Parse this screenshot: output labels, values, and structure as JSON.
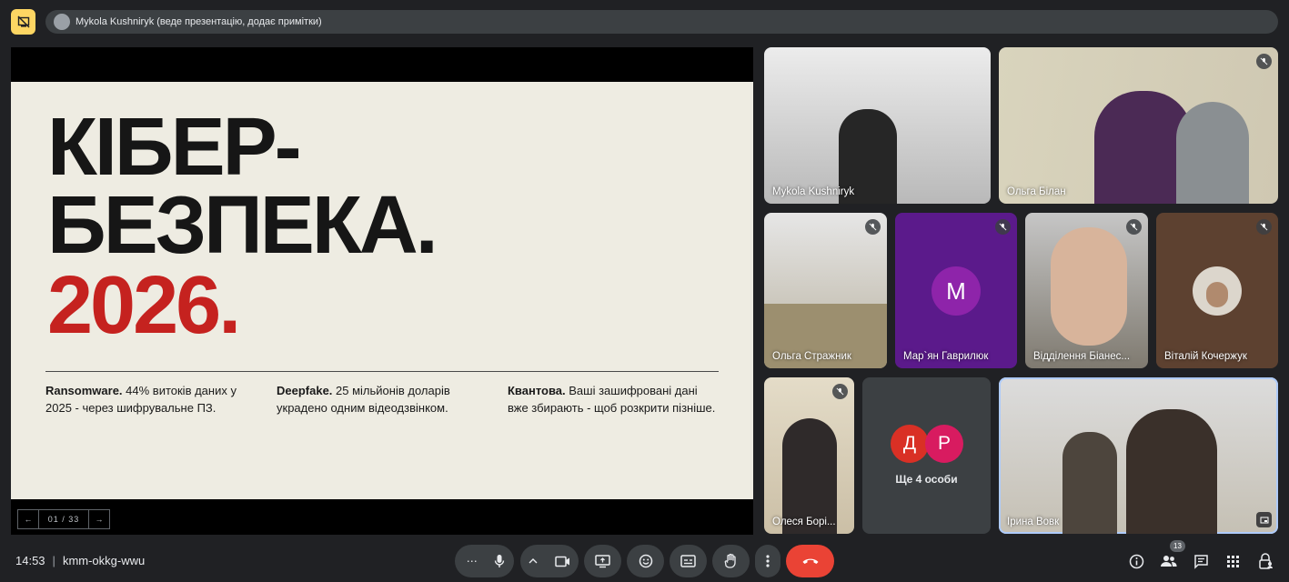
{
  "presenter_bar": {
    "label": "Mykola Kushniryk (веде презентацію, додає примітки)"
  },
  "slide": {
    "heading_line1": "КІБЕР-",
    "heading_line2": "БЕЗПЕКА.",
    "heading_line3": "2026.",
    "columns": [
      {
        "title": "Ransomware.",
        "text": " 44% витоків даних у 2025 - через шифрувальне ПЗ."
      },
      {
        "title": "Deepfake.",
        "text": " 25 мільйонів доларів украдено одним відеодзвінком."
      },
      {
        "title": "Квантова.",
        "text": " Ваші зашифровані дані вже збирають - щоб розкрити пізніше."
      }
    ],
    "page_indicator": "01 / 33",
    "prev": "←",
    "next": "→"
  },
  "participants": [
    {
      "name": "Mykola Kushniryk"
    },
    {
      "name": "Ольга Білан"
    },
    {
      "name": "Ольга Стражник"
    },
    {
      "name": "Мар`ян Гаврилюк",
      "initial": "M"
    },
    {
      "name": "Відділення Біанес..."
    },
    {
      "name": "Віталій Кочержук"
    },
    {
      "name": "Олеся Борі..."
    },
    {
      "name": "Ірина Вовк"
    }
  ],
  "more_people": {
    "label": "Ще 4 особи",
    "initials": [
      "Д",
      "Р"
    ]
  },
  "bottom_bar": {
    "time": "14:53",
    "meeting_code": "kmm-okkg-wwu",
    "people_count": "13"
  },
  "colors": {
    "accent_red": "#c5221f",
    "end_call": "#ea4335",
    "purple_tile": "#5b1a8b",
    "highlight": "#fdd663"
  }
}
